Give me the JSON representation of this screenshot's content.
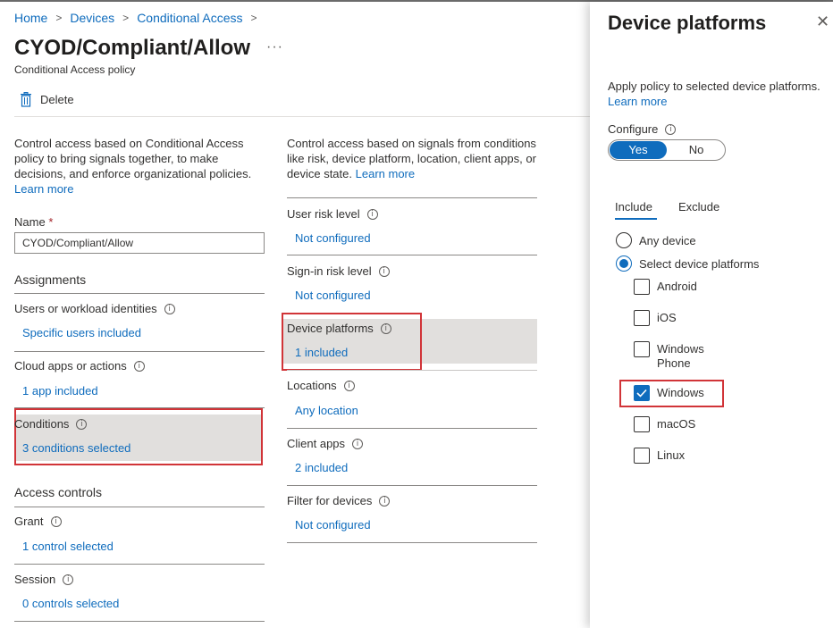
{
  "breadcrumb": {
    "items": [
      "Home",
      "Devices",
      "Conditional Access"
    ]
  },
  "page": {
    "title": "CYOD/Compliant/Allow",
    "subtitle": "Conditional Access policy",
    "more": "···"
  },
  "toolbar": {
    "delete_label": "Delete"
  },
  "left": {
    "description": "Control access based on Conditional Access policy to bring signals together, to make decisions, and enforce organizational policies.",
    "learn_more": "Learn more",
    "name_label": "Name",
    "required_mark": "*",
    "name_value": "CYOD/Compliant/Allow",
    "assignments_heading": "Assignments",
    "users_label": "Users or workload identities",
    "users_value": "Specific users included",
    "cloud_label": "Cloud apps or actions",
    "cloud_value": "1 app included",
    "conditions_label": "Conditions",
    "conditions_value": "3 conditions selected",
    "access_heading": "Access controls",
    "grant_label": "Grant",
    "grant_value": "1 control selected",
    "session_label": "Session",
    "session_value": "0 controls selected"
  },
  "middle": {
    "description": "Control access based on signals from conditions like risk, device platform, location, client apps, or device state.",
    "learn_more": "Learn more",
    "user_risk_label": "User risk level",
    "user_risk_value": "Not configured",
    "signin_risk_label": "Sign-in risk level",
    "signin_risk_value": "Not configured",
    "device_platforms_label": "Device platforms",
    "device_platforms_value": "1 included",
    "locations_label": "Locations",
    "locations_value": "Any location",
    "client_apps_label": "Client apps",
    "client_apps_value": "2 included",
    "filter_label": "Filter for devices",
    "filter_value": "Not configured"
  },
  "panel": {
    "title": "Device platforms",
    "close": "✕",
    "description": "Apply policy to selected device platforms.",
    "learn_more": "Learn more",
    "configure_label": "Configure",
    "toggle_yes": "Yes",
    "toggle_no": "No",
    "toggle_selected": "Yes",
    "tab_include": "Include",
    "tab_exclude": "Exclude",
    "radio_any": "Any device",
    "radio_select": "Select device platforms",
    "platforms": [
      {
        "label_line1": "Android",
        "label_line2": "",
        "checked": false
      },
      {
        "label_line1": "iOS",
        "label_line2": "",
        "checked": false
      },
      {
        "label_line1": "Windows",
        "label_line2": "Phone",
        "checked": false
      },
      {
        "label_line1": "Windows",
        "label_line2": "",
        "checked": true
      },
      {
        "label_line1": "macOS",
        "label_line2": "",
        "checked": false
      },
      {
        "label_line1": "Linux",
        "label_line2": "",
        "checked": false
      }
    ]
  },
  "colors": {
    "accent": "#0f6cbd",
    "highlight_box": "#d13438",
    "selected_row_bg": "#e1dfdd"
  },
  "icons": {
    "delete": "trash-icon",
    "info": "info-icon",
    "breadcrumb_separator": "chevron-right-icon",
    "checkmark": "checkmark-icon"
  }
}
